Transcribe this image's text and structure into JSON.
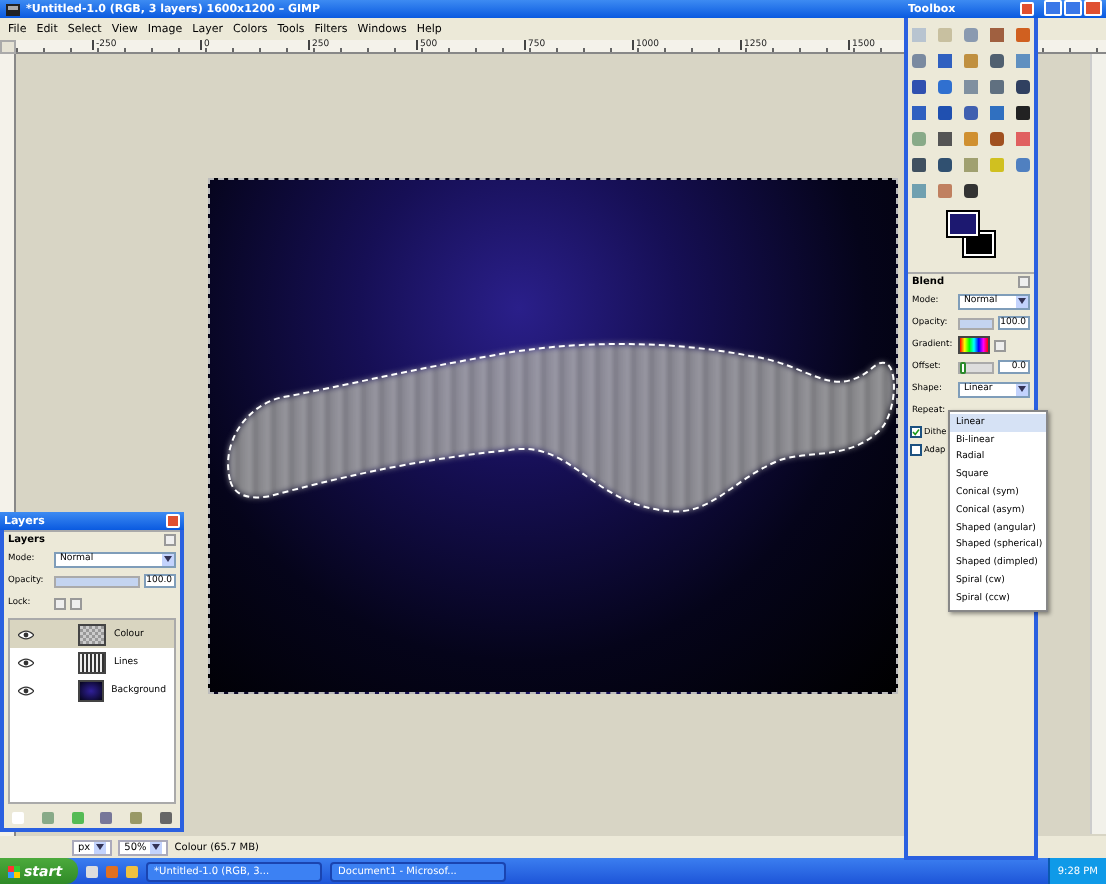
{
  "window": {
    "title": "*Untitled-1.0 (RGB, 3 layers) 1600x1200 – GIMP"
  },
  "menu": [
    "File",
    "Edit",
    "Select",
    "View",
    "Image",
    "Layer",
    "Colors",
    "Tools",
    "Filters",
    "Windows",
    "Help"
  ],
  "ruler": [
    "-250",
    "0",
    "250",
    "500",
    "750",
    "1000",
    "1250",
    "1500"
  ],
  "status_bar": {
    "unit": "px",
    "zoom": "50%",
    "message": "Colour (65.7 MB)"
  },
  "toolbox": {
    "title": "Toolbox",
    "swatches": [
      {
        "kind": "background",
        "color": "#000000"
      },
      {
        "kind": "foreground",
        "color": "#1c1870"
      }
    ]
  },
  "tool_options": {
    "title": "Blend",
    "mode_label": "Mode:",
    "mode": "Normal",
    "opacity_label": "Opacity:",
    "opacity": {
      "value": "100.0",
      "level": 1
    },
    "gradient_label": "Gradient:",
    "offset_label": "Offset:",
    "offset": {
      "value": "0.0",
      "level": 0
    },
    "shape_label": "Shape:",
    "shape": "Linear",
    "repeat_label": "Repeat:",
    "checkboxes": [
      {
        "label": "Dithe",
        "checked": true
      },
      {
        "label": "Adap",
        "checked": false
      }
    ]
  },
  "shape_menu": [
    {
      "label": "Linear",
      "selected": true
    },
    {
      "label": "Bi-linear",
      "selected": false
    },
    {
      "label": "Radial",
      "selected": false
    },
    {
      "label": "Square",
      "selected": false
    },
    {
      "label": "Conical (sym)",
      "selected": false
    },
    {
      "label": "Conical (asym)",
      "selected": false
    },
    {
      "label": "Shaped (angular)",
      "selected": false
    },
    {
      "label": "Shaped (spherical)",
      "selected": false
    },
    {
      "label": "Shaped (dimpled)",
      "selected": false
    },
    {
      "label": "Spiral (cw)",
      "selected": false
    },
    {
      "label": "Spiral (ccw)",
      "selected": false
    }
  ],
  "layers_dialog": {
    "title": "Layers",
    "tab": "Layers",
    "mode_label": "Mode:",
    "mode": "Normal",
    "opacity_label": "Opacity:",
    "opacity": {
      "value": "100.0",
      "level": 1
    },
    "lock_label": "Lock:",
    "layers": [
      {
        "name": "Colour",
        "selected": true,
        "visible": true,
        "kind": "noise"
      },
      {
        "name": "Lines",
        "selected": false,
        "visible": true,
        "kind": "lines"
      },
      {
        "name": "Background",
        "selected": false,
        "visible": true,
        "kind": "background"
      }
    ]
  },
  "taskbar": {
    "start": "start",
    "tasks": [
      {
        "label": "*Untitled-1.0 (RGB, 3...",
        "selected": false
      },
      {
        "label": "Document1 - Microsof...",
        "selected": false
      }
    ],
    "clock": "9:28 PM"
  }
}
